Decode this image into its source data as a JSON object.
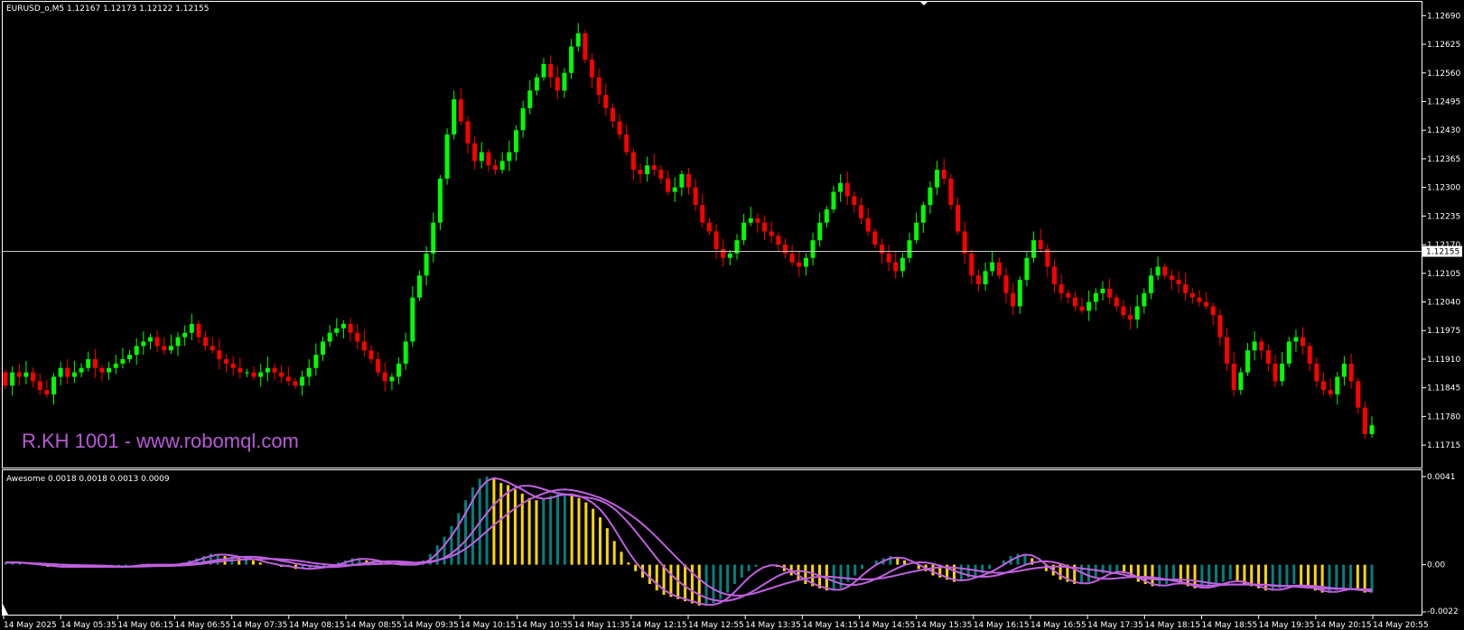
{
  "header": {
    "symbol_info": "EURUSD_o,M5  1.12167 1.12173 1.12122 1.12155",
    "indicator_info": "Awesome 0.0018 0.0018 0.0013 0.0009"
  },
  "watermark": "R.KH 1001 - www.robomql.com",
  "current_price_label": "1.12155",
  "colors": {
    "background": "#000000",
    "bull": "#00ff00",
    "bear": "#ff0000",
    "ao_up": "#008080",
    "ao_down": "#ffd700",
    "signal": "#c060e0",
    "watermark": "#b85ad6",
    "grid_text": "#ffffff"
  },
  "chart_data": [
    {
      "type": "candlestick",
      "title": "",
      "y_ticks": [
        "1.12690",
        "1.12625",
        "1.12560",
        "1.12495",
        "1.12430",
        "1.12365",
        "1.12300",
        "1.12235",
        "1.12170",
        "1.12105",
        "1.12040",
        "1.11975",
        "1.11910",
        "1.11845",
        "1.11780",
        "1.11715"
      ],
      "ylim": [
        1.11705,
        1.12705
      ],
      "x_ticks": [
        "14 May 2025",
        "14 May 05:35",
        "14 May 06:15",
        "14 May 06:55",
        "14 May 07:35",
        "14 May 08:15",
        "14 May 08:55",
        "14 May 09:35",
        "14 May 10:15",
        "14 May 10:55",
        "14 May 11:35",
        "14 May 12:15",
        "14 May 12:55",
        "14 May 13:35",
        "14 May 14:15",
        "14 May 14:55",
        "14 May 15:35",
        "14 May 16:15",
        "14 May 16:55",
        "14 May 17:35",
        "14 May 18:15",
        "14 May 18:55",
        "14 May 19:35",
        "14 May 20:15",
        "14 May 20:55"
      ],
      "current_price": 1.12155,
      "close": [
        1.1185,
        1.1188,
        1.1187,
        1.1188,
        1.1186,
        1.1184,
        1.1183,
        1.1187,
        1.1189,
        1.1187,
        1.1188,
        1.1189,
        1.1191,
        1.1189,
        1.1188,
        1.1189,
        1.119,
        1.1191,
        1.1192,
        1.1194,
        1.1195,
        1.1196,
        1.1194,
        1.1193,
        1.1194,
        1.1196,
        1.1197,
        1.1199,
        1.1196,
        1.1194,
        1.1193,
        1.1191,
        1.119,
        1.1189,
        1.1188,
        1.1188,
        1.1187,
        1.1188,
        1.1189,
        1.1188,
        1.1187,
        1.1186,
        1.1185,
        1.1187,
        1.1189,
        1.1192,
        1.1195,
        1.1197,
        1.1198,
        1.1199,
        1.1197,
        1.1195,
        1.1193,
        1.1191,
        1.1188,
        1.1186,
        1.1187,
        1.119,
        1.1195,
        1.1205,
        1.121,
        1.1215,
        1.1222,
        1.1232,
        1.1242,
        1.125,
        1.1245,
        1.124,
        1.1236,
        1.1238,
        1.1235,
        1.1234,
        1.1236,
        1.1238,
        1.1243,
        1.1248,
        1.1252,
        1.1255,
        1.1258,
        1.1255,
        1.1252,
        1.1256,
        1.1262,
        1.1265,
        1.1259,
        1.1255,
        1.1251,
        1.1248,
        1.1245,
        1.1242,
        1.1238,
        1.1234,
        1.1233,
        1.1235,
        1.1234,
        1.1232,
        1.1229,
        1.123,
        1.1233,
        1.123,
        1.1226,
        1.1222,
        1.122,
        1.1216,
        1.1214,
        1.1215,
        1.1218,
        1.1222,
        1.1223,
        1.1222,
        1.122,
        1.1219,
        1.1217,
        1.1215,
        1.1213,
        1.1212,
        1.1214,
        1.1218,
        1.1222,
        1.1225,
        1.1229,
        1.1231,
        1.1228,
        1.1226,
        1.1223,
        1.122,
        1.1217,
        1.1215,
        1.1213,
        1.1211,
        1.1214,
        1.1218,
        1.1222,
        1.1226,
        1.123,
        1.1234,
        1.1232,
        1.1226,
        1.122,
        1.1215,
        1.121,
        1.1208,
        1.1211,
        1.1213,
        1.121,
        1.1206,
        1.1203,
        1.1209,
        1.1214,
        1.1218,
        1.1216,
        1.1212,
        1.1208,
        1.1206,
        1.1205,
        1.1203,
        1.1202,
        1.1204,
        1.1206,
        1.1207,
        1.1205,
        1.1203,
        1.1201,
        1.12,
        1.1203,
        1.1206,
        1.121,
        1.1212,
        1.121,
        1.1209,
        1.1208,
        1.1206,
        1.1205,
        1.1204,
        1.1203,
        1.1201,
        1.1196,
        1.119,
        1.1184,
        1.1188,
        1.1193,
        1.1195,
        1.1193,
        1.119,
        1.1186,
        1.119,
        1.1195,
        1.1196,
        1.1194,
        1.119,
        1.1186,
        1.1184,
        1.1183,
        1.1187,
        1.119,
        1.1186,
        1.118,
        1.1174,
        1.1176
      ]
    },
    {
      "type": "bar",
      "title": "",
      "y_ticks": [
        "0.0041",
        "0.00",
        "-0.0022"
      ],
      "ylim": [
        -0.0022,
        0.0041
      ],
      "values": [
        0.0001,
        0.0001,
        0.0001,
        0.0,
        0.0,
        0.0,
        -0.0001,
        -0.0001,
        -0.0001,
        -0.0001,
        -0.0001,
        -0.0001,
        -0.0001,
        -0.0001,
        -0.0001,
        -0.0001,
        -0.0001,
        -0.0001,
        0.0,
        0.0,
        0.0,
        0.0,
        0.0,
        0.0,
        0.0,
        0.0001,
        0.0002,
        0.0003,
        0.0004,
        0.0005,
        0.0005,
        0.0004,
        0.0004,
        0.0003,
        0.0003,
        0.0002,
        0.0001,
        0.0,
        0.0,
        -0.0001,
        -0.0001,
        -0.0002,
        -0.0002,
        -0.0002,
        -0.0001,
        -0.0001,
        0.0,
        0.0001,
        0.0002,
        0.0003,
        0.0003,
        0.0002,
        0.0002,
        0.0001,
        0.0,
        0.0,
        0.0,
        0.0,
        0.0,
        0.0002,
        0.0005,
        0.0009,
        0.0013,
        0.0018,
        0.0024,
        0.003,
        0.0036,
        0.004,
        0.0041,
        0.004,
        0.0038,
        0.0037,
        0.0035,
        0.0033,
        0.0031,
        0.003,
        0.0031,
        0.0032,
        0.0033,
        0.0033,
        0.0032,
        0.0031,
        0.0029,
        0.0026,
        0.0022,
        0.0017,
        0.0011,
        0.0006,
        0.0001,
        -0.0003,
        -0.0006,
        -0.0009,
        -0.0012,
        -0.0014,
        -0.0015,
        -0.0016,
        -0.0017,
        -0.0018,
        -0.0019,
        -0.0019,
        -0.0018,
        -0.0016,
        -0.0013,
        -0.0009,
        -0.0006,
        -0.0003,
        -0.0001,
        0.0,
        0.0,
        -0.0001,
        -0.0003,
        -0.0005,
        -0.0007,
        -0.0009,
        -0.001,
        -0.0011,
        -0.0012,
        -0.0012,
        -0.0011,
        -0.0008,
        -0.0005,
        -0.0002,
        0.0,
        0.0002,
        0.0003,
        0.0004,
        0.0003,
        0.0002,
        0.0,
        -0.0002,
        -0.0003,
        -0.0005,
        -0.0006,
        -0.0007,
        -0.0008,
        -0.0007,
        -0.0006,
        -0.0005,
        -0.0004,
        -0.0002,
        0.0,
        0.0002,
        0.0004,
        0.0005,
        0.0005,
        0.0003,
        0.0,
        -0.0003,
        -0.0005,
        -0.0007,
        -0.0008,
        -0.0009,
        -0.0009,
        -0.0008,
        -0.0006,
        -0.0004,
        -0.0003,
        -0.0003,
        -0.0004,
        -0.0006,
        -0.0008,
        -0.0009,
        -0.001,
        -0.001,
        -0.0009,
        -0.0008,
        -0.0009,
        -0.001,
        -0.0011,
        -0.0011,
        -0.001,
        -0.0009,
        -0.0008,
        -0.0007,
        -0.0008,
        -0.0009,
        -0.001,
        -0.0011,
        -0.0012,
        -0.0012,
        -0.0011,
        -0.001,
        -0.0009,
        -0.001,
        -0.0011,
        -0.0012,
        -0.0013,
        -0.0013,
        -0.0012,
        -0.0011,
        -0.0011,
        -0.0012,
        -0.0013,
        -0.0013
      ]
    }
  ]
}
